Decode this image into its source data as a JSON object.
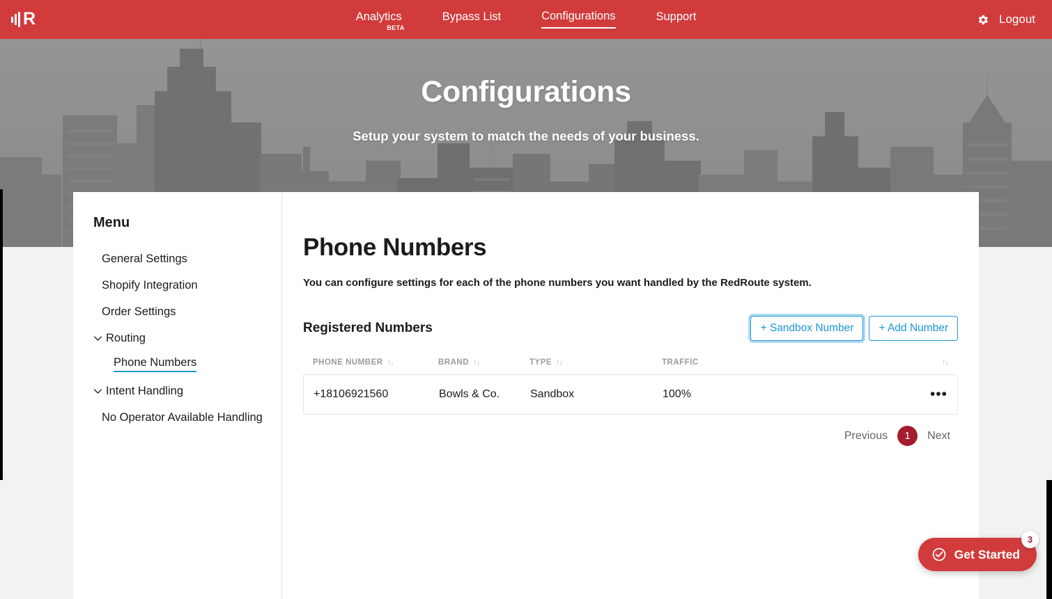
{
  "topnav": {
    "logo_name": "redroute-logo",
    "items": [
      {
        "label": "Analytics",
        "badge": "BETA",
        "active": false
      },
      {
        "label": "Bypass List",
        "badge": "",
        "active": false
      },
      {
        "label": "Configurations",
        "badge": "",
        "active": true
      },
      {
        "label": "Support",
        "badge": "",
        "active": false
      }
    ],
    "gear_icon": "gear-icon",
    "logout_label": "Logout",
    "background_color": "#d13b3b"
  },
  "hero": {
    "title": "Configurations",
    "subtitle": "Setup your system to match the needs of your business."
  },
  "sidebar": {
    "title": "Menu",
    "items": [
      {
        "label": "General Settings",
        "level": 1,
        "chevron": false,
        "active": false
      },
      {
        "label": "Shopify Integration",
        "level": 1,
        "chevron": false,
        "active": false
      },
      {
        "label": "Order Settings",
        "level": 1,
        "chevron": false,
        "active": false
      },
      {
        "label": "Routing",
        "level": 1,
        "chevron": true,
        "active": false
      },
      {
        "label": "Phone Numbers",
        "level": 2,
        "chevron": false,
        "active": true
      },
      {
        "label": "Intent Handling",
        "level": 1,
        "chevron": true,
        "active": false
      },
      {
        "label": "No Operator Available Handling",
        "level": 1,
        "chevron": false,
        "active": false
      }
    ],
    "active_underline_color": "#1b98d6"
  },
  "main": {
    "title": "Phone Numbers",
    "description": "You can configure settings for each of the phone numbers you want handled by the RedRoute system.",
    "section_title": "Registered Numbers",
    "buttons": {
      "sandbox": "+ Sandbox Number",
      "add": "+ Add Number"
    },
    "accent_color": "#1b98d6",
    "table": {
      "columns": [
        {
          "header": "PHONE NUMBER",
          "sortable": true
        },
        {
          "header": "BRAND",
          "sortable": true
        },
        {
          "header": "TYPE",
          "sortable": true
        },
        {
          "header": "TRAFFIC",
          "sortable": true
        }
      ],
      "sort_glyph": "↑↓",
      "rows": [
        {
          "phone_number": "+18106921560",
          "brand": "Bowls & Co.",
          "type": "Sandbox",
          "traffic": "100%",
          "actions_glyph": "•••"
        }
      ]
    },
    "pagination": {
      "previous": "Previous",
      "current_page": "1",
      "next": "Next",
      "current_color": "#a51c2c"
    }
  },
  "get_started": {
    "label": "Get Started",
    "badge": "3",
    "icon": "check-circle-icon",
    "color": "#d13b3b"
  }
}
